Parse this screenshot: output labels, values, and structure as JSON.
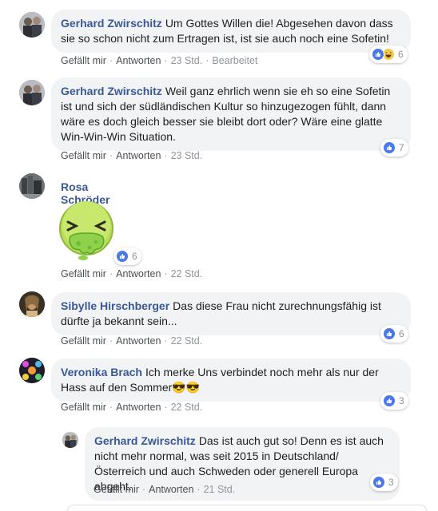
{
  "actions": {
    "like": "Gefällt mir",
    "reply": "Antworten",
    "separator": "·",
    "edited": "Bearbeitet"
  },
  "colors": {
    "author": "#385898",
    "bubble": "#f2f3f5",
    "like_blue": "#4a78e8",
    "meta_gray": "#90949c"
  },
  "comments": [
    {
      "author": "Gerhard Zwirschitz",
      "text": "Um Gottes Willen die! Abgesehen davon dass sie so schon nicht zum Ertragen ist, ist sie auch noch eine Sofetin!",
      "time": "23 Std.",
      "reactions": [
        "like-icon",
        "haha-icon"
      ],
      "reaction_count": "6"
    },
    {
      "author": "Gerhard Zwirschitz",
      "text": "Weil ganz ehrlich wenn sie eh so eine Sofetin ist und sich der südländischen Kultur so hinzugezogen fühlt, dann wäre es doch gleich besser sie bleibt dort oder? Wäre eine glatte Win-Win-Win Situation.",
      "time": "23 Std.",
      "reactions": [
        "like-icon"
      ],
      "reaction_count": "7"
    },
    {
      "author": "Rosa Schröder",
      "sticker": "vomiting-emoji-sticker",
      "time": "22 Std.",
      "reactions": [
        "like-icon"
      ],
      "reaction_count": "6"
    },
    {
      "author": "Sibylle Hirschberger",
      "text": "Das diese Frau nicht zurechnungsfähig ist dürfte ja bekannt sein...",
      "time": "22 Std.",
      "reactions": [
        "like-icon"
      ],
      "reaction_count": "6"
    },
    {
      "author": "Veronika Brach",
      "text": "Ich merke Uns verbindet noch mehr als nur der Hass auf den Sommer",
      "emoji": "😎😎",
      "time": "22 Std.",
      "reactions": [
        "like-icon"
      ],
      "reaction_count": "3"
    },
    {
      "author": "Gerhard Zwirschitz",
      "text": "Das ist auch gut so! Denn es ist auch nicht mehr normal, was seit 2015 in Deutschland/Österreich und auch Schweden oder generell Europa abgeht.",
      "time": "21 Std.",
      "reactions": [
        "like-icon"
      ],
      "reaction_count": "3",
      "is_reply": true
    }
  ]
}
